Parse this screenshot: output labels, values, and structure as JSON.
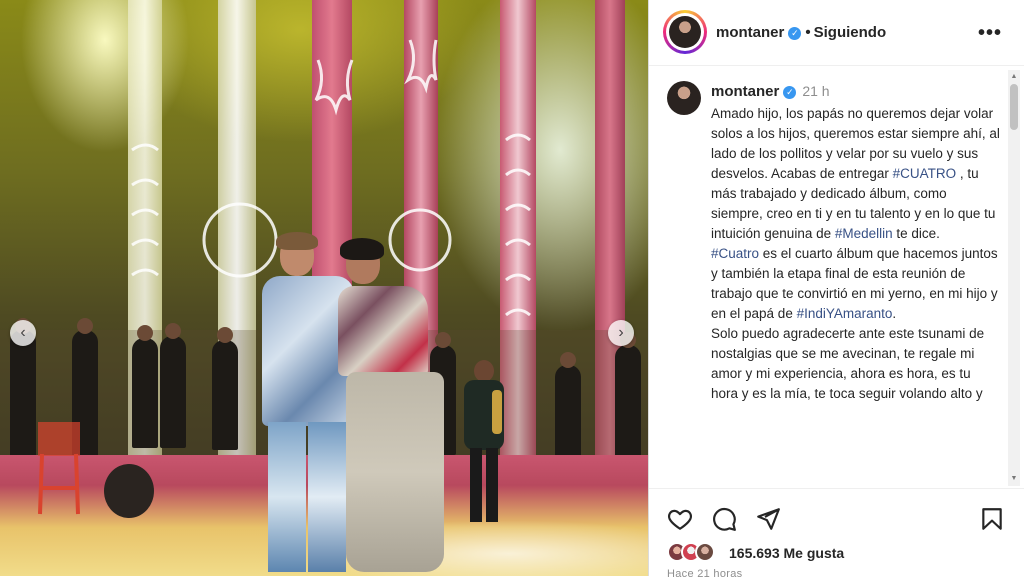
{
  "post": {
    "username": "montaner",
    "verified_mark": "✓",
    "separator": "•",
    "follow_status": "Siguiendo",
    "more_icon": "•••",
    "time_ago": "21 h",
    "caption_parts": [
      {
        "t": "Amado hijo, los papás no queremos dejar volar solos a los hijos, queremos estar siempre ahí, al lado de los pollitos y velar por su vuelo y sus desvelos. Acabas de entregar ",
        "tag": false
      },
      {
        "t": "#CUATRO",
        "tag": true
      },
      {
        "t": " , tu más trabajado y dedicado álbum, como siempre, creo en ti y en tu talento y en lo que tu intuición genuina de ",
        "tag": false
      },
      {
        "t": "#Medellin",
        "tag": true
      },
      {
        "t": " te dice.",
        "tag": false
      },
      {
        "t": "\n",
        "tag": false
      },
      {
        "t": "#Cuatro",
        "tag": true
      },
      {
        "t": " es el cuarto álbum que hacemos juntos y también la etapa final de esta reunión de trabajo que te convirtió en mi yerno, en mi hijo y en el papá de ",
        "tag": false
      },
      {
        "t": "#IndiYAmaranto",
        "tag": true
      },
      {
        "t": ".",
        "tag": false
      },
      {
        "t": "\n",
        "tag": false
      },
      {
        "t": "Solo puedo agradecerte ante este tsunami de nostalgias que se me avecinan, te regale mi amor y mi experiencia, ahora es hora, es tu hora y es la mía, te toca seguir volando alto y",
        "tag": false
      }
    ],
    "likes": "165.693 Me gusta",
    "posted_ago": "Hace 21 horas"
  },
  "carousel": {
    "prev_icon": "‹",
    "next_icon": "›"
  },
  "colors": {
    "verified": "#3897f0",
    "hashtag": "#385185",
    "muted": "#8e8e8e",
    "text": "#262626"
  },
  "icons": {
    "like": "heart-icon",
    "comment": "comment-icon",
    "share": "paper-plane-icon",
    "save": "bookmark-icon"
  }
}
